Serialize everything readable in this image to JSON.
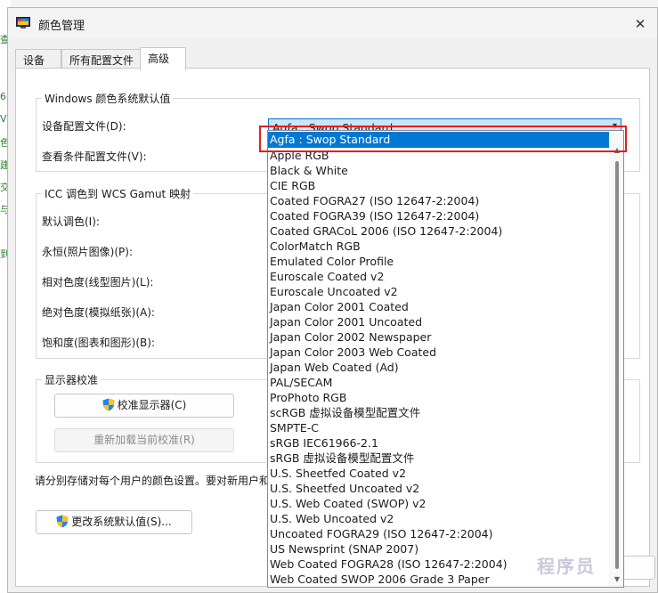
{
  "background": {
    "fragments": [
      "查",
      "6",
      "Vi",
      "色",
      "建",
      "交",
      "与",
      "到"
    ]
  },
  "window": {
    "title": "颜色管理",
    "close_glyph": "✕"
  },
  "tabs": [
    {
      "label": "设备"
    },
    {
      "label": "所有配置文件"
    },
    {
      "label": "高级"
    }
  ],
  "defaults_group": {
    "title": "Windows 颜色系统默认值",
    "device_profile_label": "设备配置文件(D):",
    "device_profile_value": "Agfa : Swop Standard",
    "viewing_conditions_label": "查看条件配置文件(V):"
  },
  "icc_group": {
    "title": "ICC 调色到 WCS Gamut 映射",
    "default_label": "默认调色(I):",
    "perceptual_label": "永恒(照片图像)(P):",
    "relative_label": "相对色度(线型图片)(L):",
    "absolute_label": "绝对色度(模拟纸张)(A):",
    "saturation_label": "饱和度(图表和图形)(B):"
  },
  "calibration_group": {
    "title": "显示器校准",
    "calibrate_button": "校准显示器(C)",
    "reload_button": "重新加载当前校准(R)"
  },
  "note_text": "请分别存储对每个用户的颜色设置。要对新用户和",
  "change_defaults_button": "更改系统默认值(S)...",
  "dropdown": {
    "items": [
      "Agfa : Swop Standard",
      "Apple RGB",
      "Black & White",
      "CIE RGB",
      "Coated FOGRA27 (ISO 12647-2:2004)",
      "Coated FOGRA39 (ISO 12647-2:2004)",
      "Coated GRACoL 2006 (ISO 12647-2:2004)",
      "ColorMatch RGB",
      "Emulated Color Profile",
      "Euroscale Coated v2",
      "Euroscale Uncoated v2",
      "Japan Color 2001 Coated",
      "Japan Color 2001 Uncoated",
      "Japan Color 2002 Newspaper",
      "Japan Color 2003 Web Coated",
      "Japan Web Coated (Ad)",
      "PAL/SECAM",
      "ProPhoto RGB",
      "scRGB 虚拟设备模型配置文件",
      "SMPTE-C",
      "sRGB IEC61966-2.1",
      "sRGB 虚拟设备模型配置文件",
      "U.S. Sheetfed Coated v2",
      "U.S. Sheetfed Uncoated v2",
      "U.S. Web Coated (SWOP) v2",
      "U.S. Web Uncoated v2",
      "Uncoated FOGRA29 (ISO 12647-2:2004)",
      "US Newsprint (SNAP 2007)",
      "Web Coated FOGRA28 (ISO 12647-2:2004)",
      "Web Coated SWOP 2006 Grade 3 Paper"
    ],
    "selected_index": 0
  },
  "watermark": "程序员",
  "colors": {
    "accent": "#0078d4",
    "highlight_border": "#e02020"
  }
}
